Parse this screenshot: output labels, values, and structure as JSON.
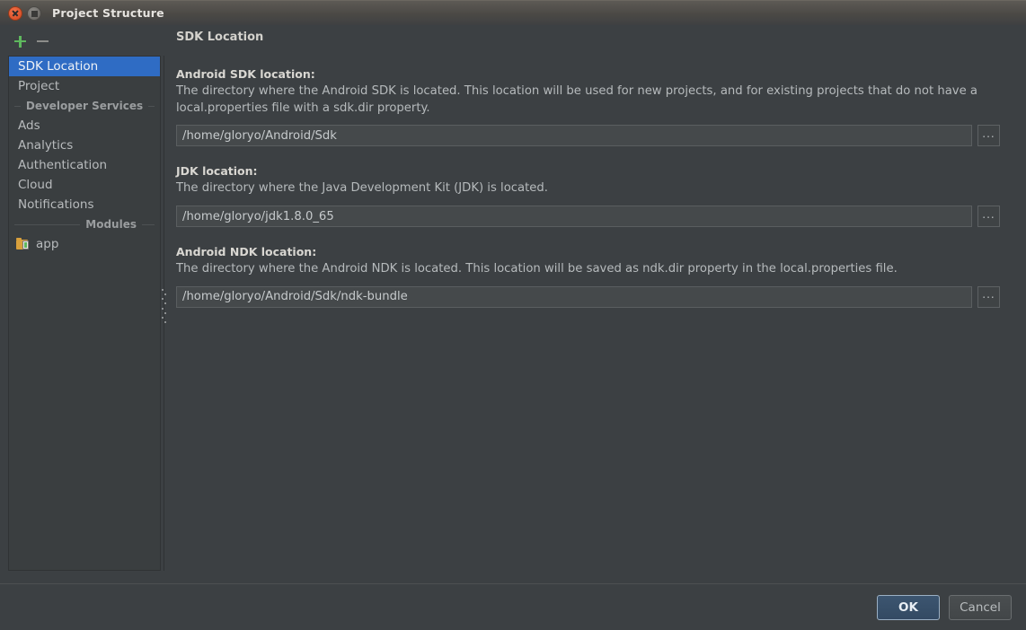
{
  "window": {
    "title": "Project Structure",
    "close_icon": "close-icon",
    "maximize_icon": "maximize-icon"
  },
  "toolbar": {
    "add_label": "+",
    "remove_label": "−"
  },
  "sidebar": {
    "items": [
      {
        "type": "item",
        "label": "SDK Location",
        "selected": true
      },
      {
        "type": "item",
        "label": "Project",
        "selected": false
      },
      {
        "type": "group",
        "label": "Developer Services"
      },
      {
        "type": "item",
        "label": "Ads",
        "selected": false
      },
      {
        "type": "item",
        "label": "Analytics",
        "selected": false
      },
      {
        "type": "item",
        "label": "Authentication",
        "selected": false
      },
      {
        "type": "item",
        "label": "Cloud",
        "selected": false
      },
      {
        "type": "item",
        "label": "Notifications",
        "selected": false
      },
      {
        "type": "group",
        "label": "Modules"
      },
      {
        "type": "module",
        "label": "app",
        "icon": "module-folder-icon"
      }
    ]
  },
  "main": {
    "panel_title": "SDK Location",
    "fields": [
      {
        "label": "Android SDK location:",
        "description": "The directory where the Android SDK is located. This location will be used for new projects, and for existing projects that do not have a local.properties file with a sdk.dir property.",
        "value": "/home/gloryo/Android/Sdk",
        "browse_label": "...",
        "input_width": 886
      },
      {
        "label": "JDK location:",
        "description": "The directory where the Java Development Kit (JDK) is located.",
        "value": "/home/gloryo/jdk1.8.0_65",
        "browse_label": "...",
        "input_width": 886
      },
      {
        "label": "Android NDK location:",
        "description": "The directory where the Android NDK is located. This location will be saved as ndk.dir property in the local.properties file.",
        "value": "/home/gloryo/Android/Sdk/ndk-bundle",
        "browse_label": "...",
        "input_width": 886
      }
    ]
  },
  "footer": {
    "ok_label": "OK",
    "cancel_label": "Cancel"
  },
  "colors": {
    "window_bg": "#3c4043",
    "sidebar_bg": "#3a3e40",
    "selection": "#2f6cc4",
    "accent_green": "#5eb85e",
    "close_button": "#d9512a",
    "text_primary": "#d9d7d2",
    "text_secondary": "#b6babc"
  }
}
